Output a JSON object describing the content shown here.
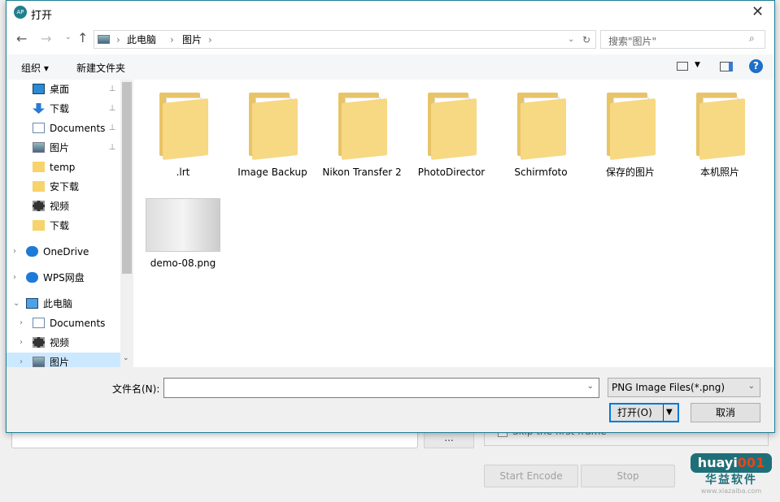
{
  "app": {
    "start_encode": "Start Encode",
    "stop": "Stop",
    "skip_first_frame": "Skip the first frame",
    "browse": "...",
    "watermark": "huayi001 华益软件 www.xiazaiba.com"
  },
  "dialog": {
    "title": "打开",
    "breadcrumb": [
      "此电脑",
      "图片"
    ],
    "search_placeholder": "搜索\"图片\"",
    "toolbar": {
      "organize": "组织 ▾",
      "new_folder": "新建文件夹"
    },
    "sidebar": [
      {
        "label": "桌面",
        "icon": "desktop-icon",
        "pinned": true
      },
      {
        "label": "下载",
        "icon": "download-icon",
        "pinned": true
      },
      {
        "label": "Documents",
        "icon": "document-icon",
        "pinned": true
      },
      {
        "label": "图片",
        "icon": "picture-icon",
        "pinned": true
      },
      {
        "label": "temp",
        "icon": "folder-icon"
      },
      {
        "label": "安下载",
        "icon": "folder-icon"
      },
      {
        "label": "视频",
        "icon": "video-icon"
      },
      {
        "label": "下载",
        "icon": "folder-icon"
      },
      {
        "label": "OneDrive",
        "icon": "cloud-icon",
        "expandable": true
      },
      {
        "label": "WPS网盘",
        "icon": "cloud-icon",
        "expandable": true
      },
      {
        "label": "此电脑",
        "icon": "computer-icon",
        "expanded": true
      },
      {
        "label": "Documents",
        "icon": "document-icon",
        "expandable": true
      },
      {
        "label": "视频",
        "icon": "video-icon",
        "expandable": true
      },
      {
        "label": "图片",
        "icon": "picture-icon",
        "expandable": true,
        "selected": true
      }
    ],
    "files": [
      ".lrt",
      "Image Backup",
      "Nikon Transfer 2",
      "PhotoDirector",
      "Schirmfoto",
      "保存的图片",
      "本机照片",
      "demo-08.png"
    ],
    "filename_label": "文件名(N):",
    "filename_value": "",
    "filetype": "PNG Image Files(*.png)",
    "open_button": "打开(O)",
    "cancel_button": "取消",
    "colors": {
      "folder": "#f7d883",
      "selection": "#cce8ff",
      "accent": "#0078d7"
    }
  }
}
